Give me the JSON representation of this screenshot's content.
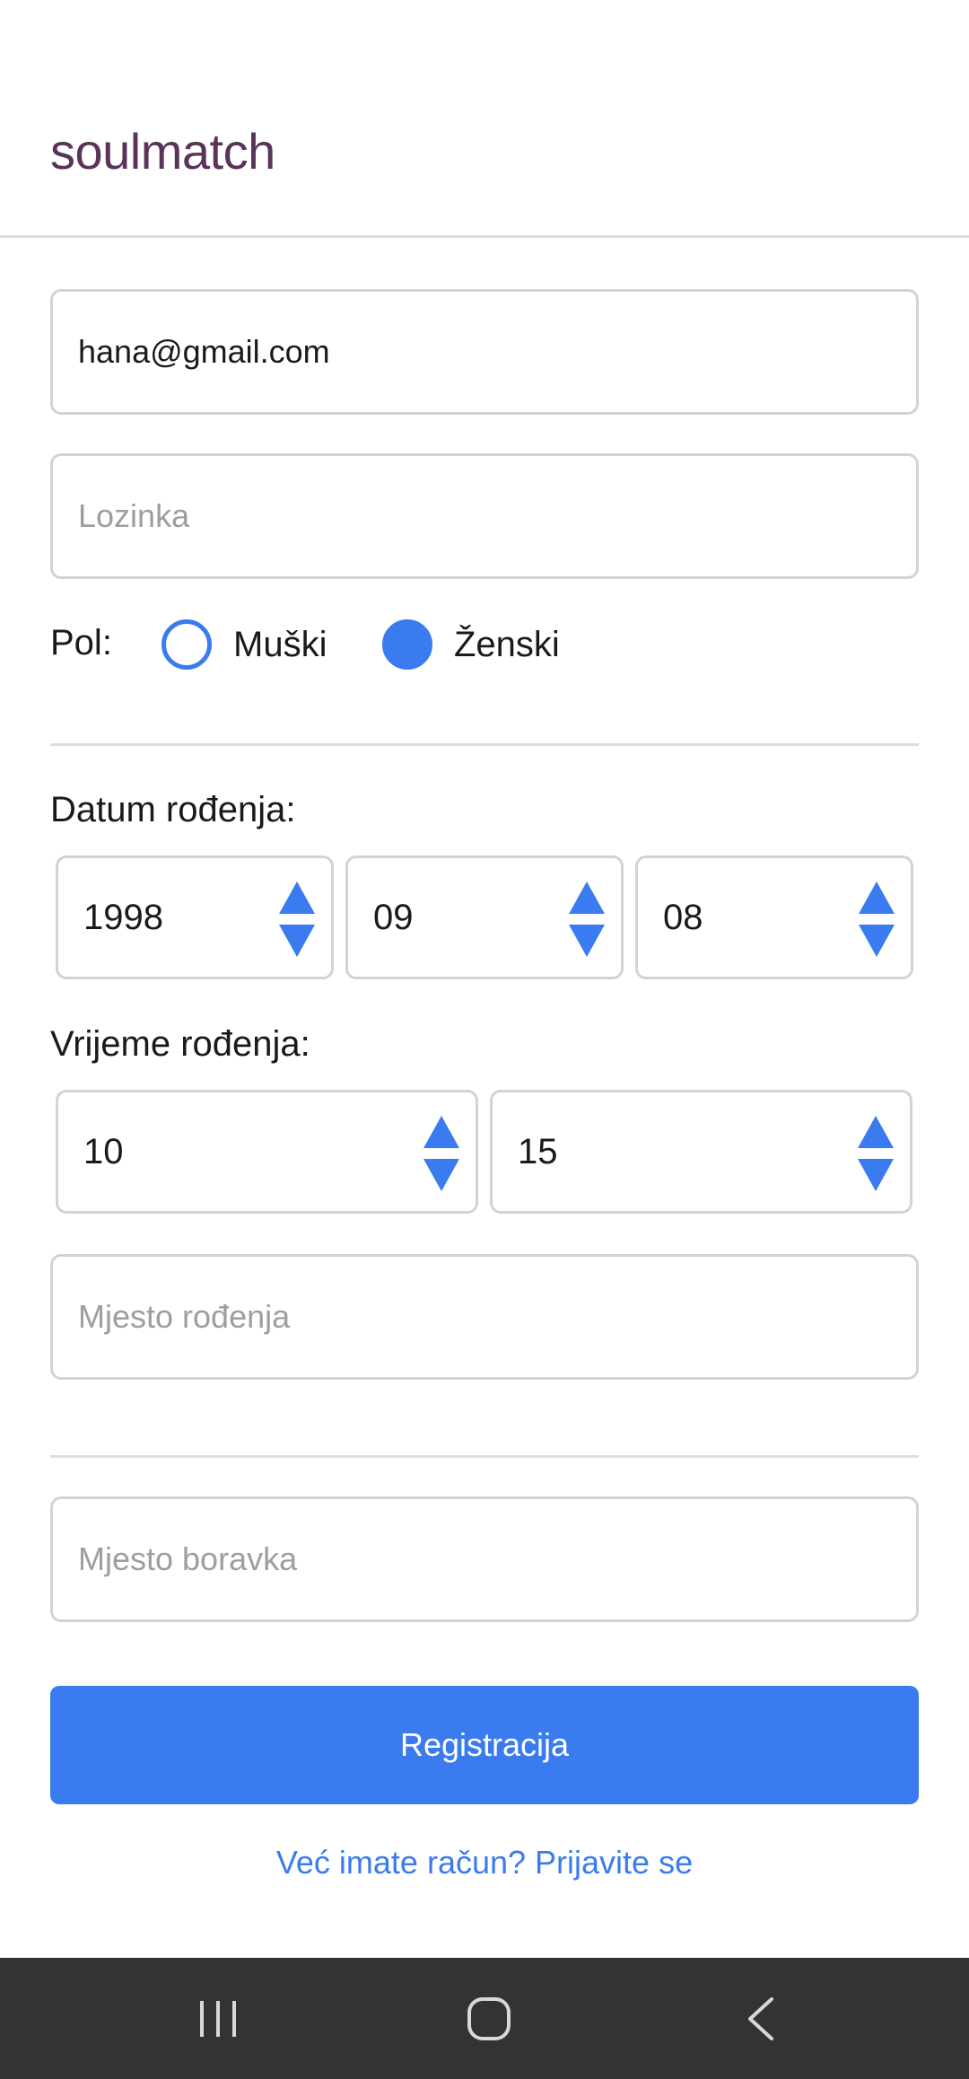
{
  "header": {
    "app_title": "soulmatch"
  },
  "form": {
    "email": {
      "value": "hana@gmail.com",
      "placeholder": ""
    },
    "password": {
      "value": "",
      "placeholder": "Lozinka"
    },
    "gender": {
      "label": "Pol:",
      "options": [
        {
          "label": "Muški",
          "selected": false
        },
        {
          "label": "Ženski",
          "selected": true
        }
      ]
    },
    "birth_date": {
      "label": "Datum rođenja:",
      "year": "1998",
      "month": "09",
      "day": "08"
    },
    "birth_time": {
      "label": "Vrijeme rođenja:",
      "hour": "10",
      "minute": "15"
    },
    "birth_place": {
      "value": "",
      "placeholder": "Mjesto rođenja"
    },
    "residence": {
      "value": "",
      "placeholder": "Mjesto boravka"
    },
    "submit_label": "Registracija",
    "login_link": "Već imate račun? Prijavite se"
  },
  "colors": {
    "brand": "#5a3358",
    "accent": "#3a7bef",
    "navbar": "#333333"
  },
  "navbar": {
    "icons": [
      "recent-apps-icon",
      "home-icon",
      "back-icon"
    ]
  }
}
